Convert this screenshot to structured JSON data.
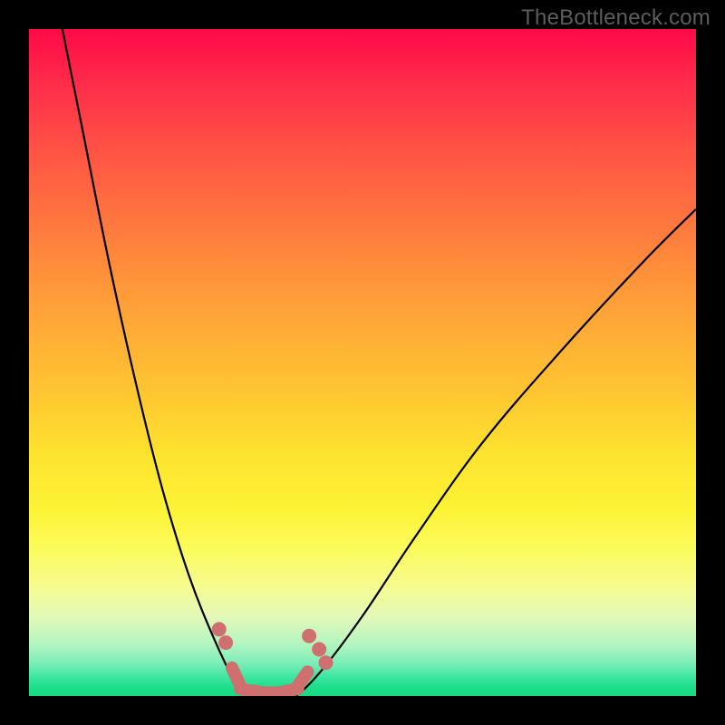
{
  "watermark": "TheBottleneck.com",
  "chart_data": {
    "type": "line",
    "title": "",
    "xlabel": "",
    "ylabel": "",
    "xlim": [
      0,
      100
    ],
    "ylim": [
      0,
      100
    ],
    "series": [
      {
        "name": "curve-left",
        "x": [
          5,
          8,
          12,
          16,
          20,
          24,
          28,
          31,
          33
        ],
        "y": [
          100,
          85,
          65,
          47,
          31,
          18,
          8,
          2,
          0
        ]
      },
      {
        "name": "curve-right",
        "x": [
          40,
          44,
          50,
          58,
          68,
          80,
          92,
          100
        ],
        "y": [
          0,
          4,
          12,
          24,
          38,
          52,
          65,
          73
        ]
      },
      {
        "name": "valley-floor",
        "x": [
          33,
          34,
          36,
          38,
          40
        ],
        "y": [
          0,
          0,
          0,
          0,
          0
        ]
      }
    ],
    "markers": [
      {
        "name": "dot-left-upper-1",
        "x": 28.5,
        "y": 10
      },
      {
        "name": "dot-left-upper-2",
        "x": 29.5,
        "y": 8
      },
      {
        "name": "dot-right-upper-1",
        "x": 42,
        "y": 9
      },
      {
        "name": "dot-right-upper-2",
        "x": 43.5,
        "y": 7
      },
      {
        "name": "dot-right-upper-3",
        "x": 44.5,
        "y": 5
      },
      {
        "name": "seg-left-lower",
        "x": 31,
        "y": 3
      },
      {
        "name": "seg-bottom-1",
        "x": 33,
        "y": 0.8
      },
      {
        "name": "seg-bottom-2",
        "x": 35,
        "y": 0.5
      },
      {
        "name": "seg-bottom-3",
        "x": 37,
        "y": 0.5
      },
      {
        "name": "seg-bottom-4",
        "x": 39,
        "y": 0.8
      },
      {
        "name": "seg-right-lower",
        "x": 41,
        "y": 2.5
      }
    ],
    "marker_color": "#cf6f6f",
    "background_gradient": [
      "#ff0a46",
      "#ffea2f",
      "#17d983"
    ]
  }
}
